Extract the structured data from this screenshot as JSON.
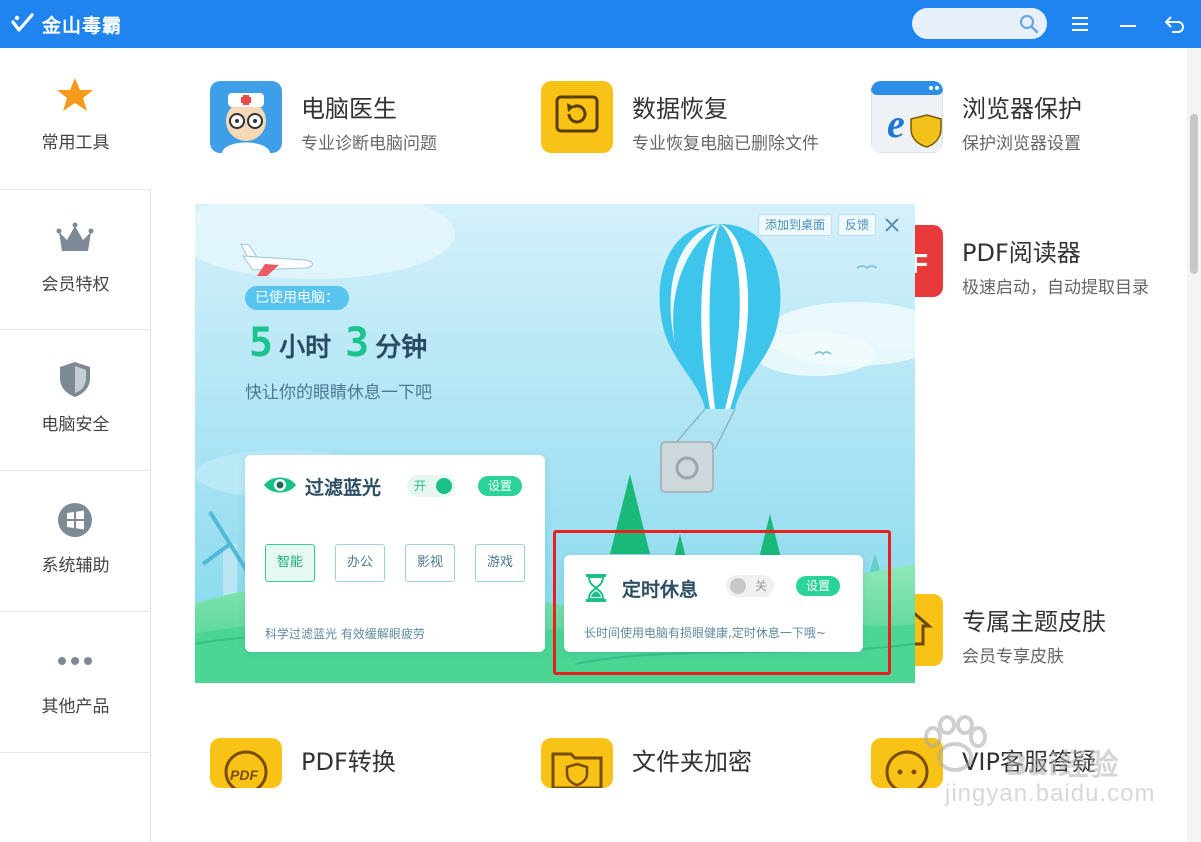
{
  "app": {
    "title": "金山毒霸"
  },
  "search": {
    "placeholder": ""
  },
  "sidebar": {
    "items": [
      {
        "label": "常用工具",
        "icon": "star-icon"
      },
      {
        "label": "会员特权",
        "icon": "crown-icon"
      },
      {
        "label": "电脑安全",
        "icon": "shield-icon"
      },
      {
        "label": "系统辅助",
        "icon": "windows-icon"
      },
      {
        "label": "其他产品",
        "icon": "more-dots-icon"
      }
    ]
  },
  "tools": {
    "row1": [
      {
        "name": "电脑医生",
        "desc": "专业诊断电脑问题"
      },
      {
        "name": "数据恢复",
        "desc": "专业恢复电脑已删除文件"
      },
      {
        "name": "浏览器保护",
        "desc": "保护浏览器设置"
      }
    ],
    "row2": [
      {
        "name": "PDF阅读器",
        "desc": "极速启动，自动提取目录"
      }
    ],
    "row3": [
      {
        "name": "专属主题皮肤",
        "desc": "会员专享皮肤"
      }
    ],
    "row4": [
      {
        "name": "PDF转换",
        "desc": ""
      },
      {
        "name": "文件夹加密",
        "desc": ""
      },
      {
        "name": "VIP客服答疑",
        "desc": ""
      }
    ]
  },
  "popup": {
    "add_desktop": "添加到桌面",
    "feedback": "反馈",
    "used_label": "已使用电脑：",
    "hours": "5",
    "hours_unit": "小时",
    "minutes": "3",
    "minutes_unit": "分钟",
    "hint": "快让你的眼睛休息一下吧",
    "blue_filter": {
      "title": "过滤蓝光",
      "toggle_label": "开",
      "toggle_on": true,
      "setting_label": "设置",
      "modes": [
        "智能",
        "办公",
        "影视",
        "游戏"
      ],
      "active_mode": "智能",
      "footer": "科学过滤蓝光 有效缓解眼疲劳"
    },
    "timer_rest": {
      "title": "定时休息",
      "toggle_label": "关",
      "toggle_on": false,
      "setting_label": "设置",
      "footer": "长时间使用电脑有损眼健康,定时休息一下哦~"
    }
  },
  "watermark": {
    "title": "Bai经验",
    "url": "jingyan.baidu.com"
  },
  "colors": {
    "titlebar": "#1f84f0",
    "accent_green": "#1bc48c",
    "highlight": "#e8201e"
  }
}
